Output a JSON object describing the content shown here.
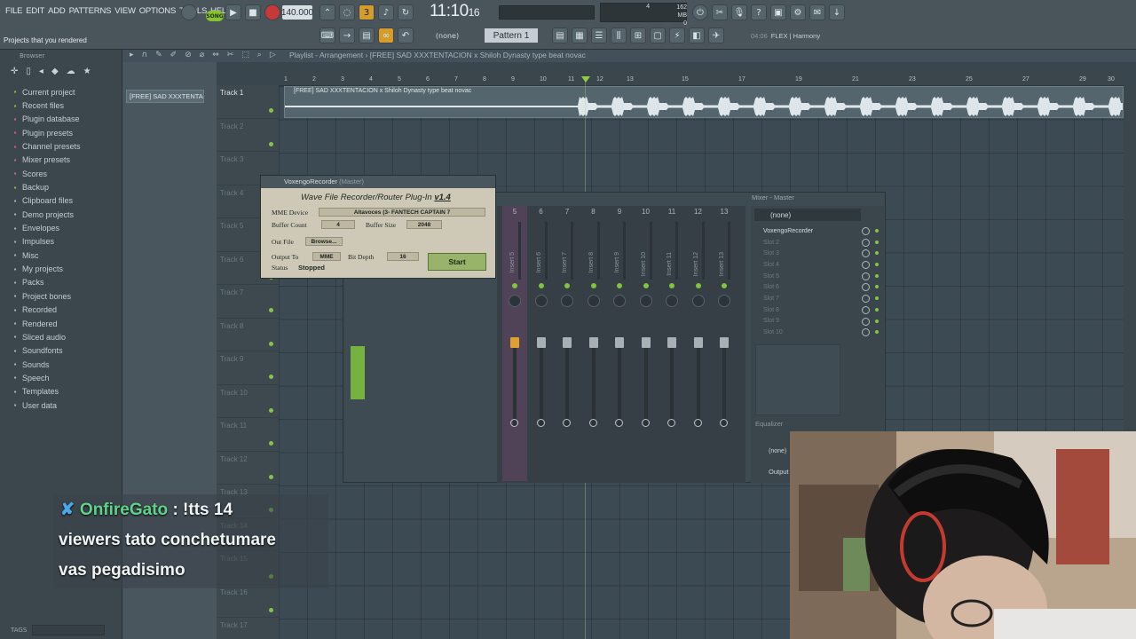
{
  "menu": [
    "FILE",
    "EDIT",
    "ADD",
    "PATTERNS",
    "VIEW",
    "OPTIONS",
    "TOOLS",
    "HELP"
  ],
  "hint": "Projects that you rendered",
  "transport": {
    "mode": "SONG",
    "tempo": "140.000",
    "time_main": "11:10",
    "time_sub": "16",
    "ram_mb": "162 MB",
    "cpu": "4",
    "voices": "0"
  },
  "pattern": {
    "none_label": "(none)",
    "selected": "Pattern 1"
  },
  "plugin_hint": {
    "time": "04:06",
    "text": "FLEX | Harmony"
  },
  "browser": {
    "title": "Browser",
    "items": [
      {
        "label": "Current project",
        "color": "green"
      },
      {
        "label": "Recent files",
        "color": "green"
      },
      {
        "label": "Plugin database",
        "color": "pink"
      },
      {
        "label": "Plugin presets",
        "color": "pink"
      },
      {
        "label": "Channel presets",
        "color": "pink"
      },
      {
        "label": "Mixer presets",
        "color": "pink"
      },
      {
        "label": "Scores",
        "color": "pink"
      },
      {
        "label": "Backup",
        "color": "green"
      },
      {
        "label": "Clipboard files",
        "color": "grey"
      },
      {
        "label": "Demo projects",
        "color": "grey"
      },
      {
        "label": "Envelopes",
        "color": "grey"
      },
      {
        "label": "Impulses",
        "color": "grey"
      },
      {
        "label": "Misc",
        "color": "grey"
      },
      {
        "label": "My projects",
        "color": "grey"
      },
      {
        "label": "Packs",
        "color": "grey"
      },
      {
        "label": "Project bones",
        "color": "grey"
      },
      {
        "label": "Recorded",
        "color": "grey"
      },
      {
        "label": "Rendered",
        "color": "grey"
      },
      {
        "label": "Sliced audio",
        "color": "grey"
      },
      {
        "label": "Soundfonts",
        "color": "grey"
      },
      {
        "label": "Sounds",
        "color": "grey"
      },
      {
        "label": "Speech",
        "color": "grey"
      },
      {
        "label": "Templates",
        "color": "grey"
      },
      {
        "label": "User data",
        "color": "grey"
      }
    ],
    "tags_label": "TAGS"
  },
  "playlist": {
    "title": "Playlist - Arrangement",
    "breadcrumb": "[FREE] SAD XXXTENTACION x Shiloh Dynasty type beat  novac",
    "picker_clip": "[FREE] SAD XXXTENTA",
    "clip_label": "[FREE] SAD XXXTENTACION x Shiloh Dynasty type beat  novac",
    "tracks": [
      "Track 1",
      "Track 2",
      "Track 3",
      "Track 4",
      "Track 5",
      "Track 6",
      "Track 7",
      "Track 8",
      "Track 9",
      "Track 10",
      "Track 11",
      "Track 12",
      "Track 13",
      "Track 14",
      "Track 15",
      "Track 16",
      "Track 17"
    ],
    "bars": [
      "1",
      "2",
      "3",
      "4",
      "5",
      "6",
      "7",
      "8",
      "9",
      "10",
      "11",
      "12",
      "13",
      "15",
      "17",
      "19",
      "21",
      "23",
      "25",
      "27",
      "29",
      "30"
    ]
  },
  "mixer": {
    "title": "Mixer - Master",
    "strips": [
      {
        "num": "5",
        "name": "Insert 5",
        "selected": true
      },
      {
        "num": "6",
        "name": "Insert 6",
        "selected": false
      },
      {
        "num": "7",
        "name": "Insert 7",
        "selected": false
      },
      {
        "num": "8",
        "name": "Insert 8",
        "selected": false
      },
      {
        "num": "9",
        "name": "Insert 9",
        "selected": false
      },
      {
        "num": "10",
        "name": "Insert 10",
        "selected": false
      },
      {
        "num": "11",
        "name": "Insert 11",
        "selected": false
      },
      {
        "num": "12",
        "name": "Insert 12",
        "selected": false
      },
      {
        "num": "13",
        "name": "Insert 13",
        "selected": false
      }
    ],
    "fx_none": "(none)",
    "slots": [
      "VoxengoRecorder",
      "Slot 2",
      "Slot 3",
      "Slot 4",
      "Slot 5",
      "Slot 6",
      "Slot 7",
      "Slot 8",
      "Slot 9",
      "Slot 10"
    ],
    "eq_label": "Equalizer",
    "side_none": "(none)",
    "side_out": "Output"
  },
  "recorder": {
    "window_title": "VoxengoRecorder",
    "window_sub": "(Master)",
    "heading": "Wave File Recorder/Router Plug-In",
    "version": "v1.4",
    "mme_device_label": "MME Device",
    "mme_device": "Altavoces (3- FANTECH CAPTAIN 7",
    "buffer_count_label": "Buffer Count",
    "buffer_count": "4",
    "buffer_size_label": "Buffer Size",
    "buffer_size": "2048",
    "out_file_label": "Out File",
    "browse_label": "Browse...",
    "output_to_label": "Output To",
    "output_to": "MME",
    "bit_depth_label": "Bit Depth",
    "bit_depth": "16",
    "start_label": "Start",
    "status_label": "Status",
    "status": "Stopped"
  },
  "chat": {
    "user": "OnfireGato",
    "sep": ":",
    "msg1": "!tts 14",
    "msg2": "viewers tato conchetumare",
    "msg3": "vas pegadisimo"
  }
}
